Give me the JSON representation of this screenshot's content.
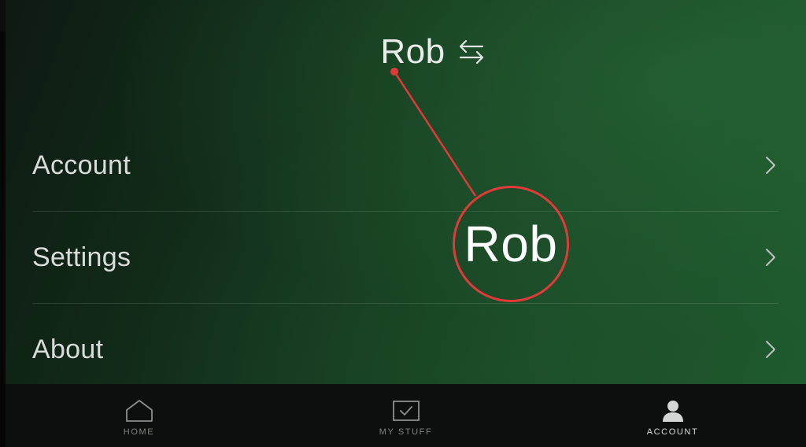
{
  "profile": {
    "name": "Rob",
    "swap_icon": "swap-arrows-icon"
  },
  "menu": {
    "items": [
      {
        "label": "Account",
        "icon": "chevron-right-icon"
      },
      {
        "label": "Settings",
        "icon": "chevron-right-icon"
      },
      {
        "label": "About",
        "icon": "chevron-right-icon"
      }
    ]
  },
  "callout": {
    "text": "Rob",
    "color": "#e23a3a"
  },
  "tabbar": {
    "tabs": [
      {
        "label": "HOME",
        "icon": "home-icon",
        "active": false
      },
      {
        "label": "MY STUFF",
        "icon": "my-stuff-icon",
        "active": false
      },
      {
        "label": "ACCOUNT",
        "icon": "account-person-icon",
        "active": true
      }
    ]
  },
  "colors": {
    "accent_green": "#1f5a2e",
    "callout_red": "#e23a3a",
    "text_primary": "#e9ece9",
    "tab_inactive": "#7d827f"
  }
}
